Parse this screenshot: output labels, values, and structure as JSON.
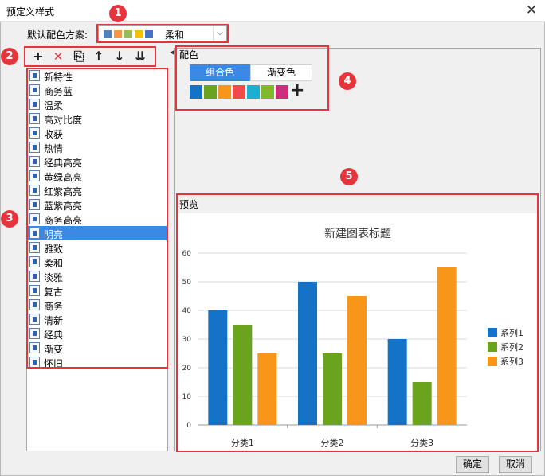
{
  "window": {
    "title": "预定义样式",
    "close_glyph": "✕"
  },
  "scheme": {
    "label": "默认配色方案:",
    "value": "柔和",
    "swatches": [
      "#4f81bd",
      "#f79646",
      "#9bbb59",
      "#f5c000",
      "#4472c4"
    ],
    "arrow_glyph": "⌵"
  },
  "toolbar": [
    {
      "name": "add",
      "glyph": "+"
    },
    {
      "name": "delete",
      "glyph": "✕"
    },
    {
      "name": "copy",
      "glyph": "⎘"
    },
    {
      "name": "move-up",
      "glyph": "↑"
    },
    {
      "name": "move-down",
      "glyph": "↓"
    },
    {
      "name": "import",
      "glyph": "⇊"
    }
  ],
  "styles": [
    "新特性",
    "商务蓝",
    "温柔",
    "高对比度",
    "收获",
    "热情",
    "经典高亮",
    "黄绿高亮",
    "红紫高亮",
    "蓝紫高亮",
    "商务高亮",
    "明亮",
    "雅致",
    "柔和",
    "淡雅",
    "复古",
    "商务",
    "清新",
    "经典",
    "渐变",
    "怀旧"
  ],
  "selected_style": "明亮",
  "splitter_glyph": "◀",
  "color": {
    "title": "配色",
    "tab_group": "组合色",
    "tab_gradient": "渐变色",
    "swatches": [
      "#1472c7",
      "#6aa31e",
      "#f79618",
      "#f24a4a",
      "#1bafd1",
      "#7fba2a",
      "#cc2e7d"
    ],
    "add_glyph": "+"
  },
  "preview": {
    "title": "预览"
  },
  "chart_data": {
    "type": "bar",
    "title": "新建图表标题",
    "categories": [
      "分类1",
      "分类2",
      "分类3"
    ],
    "series": [
      {
        "name": "系列1",
        "values": [
          40,
          50,
          30
        ],
        "color": "#1472c7"
      },
      {
        "name": "系列2",
        "values": [
          35,
          25,
          15
        ],
        "color": "#6aa31e"
      },
      {
        "name": "系列3",
        "values": [
          25,
          45,
          55
        ],
        "color": "#f79618"
      }
    ],
    "ylim": [
      0,
      60
    ],
    "yticks": [
      0,
      10,
      20,
      30,
      40,
      50,
      60
    ],
    "grid": true,
    "legend": "right"
  },
  "annotations": [
    "1",
    "2",
    "3",
    "4",
    "5"
  ],
  "buttons": {
    "ok": "确定",
    "cancel": "取消"
  }
}
